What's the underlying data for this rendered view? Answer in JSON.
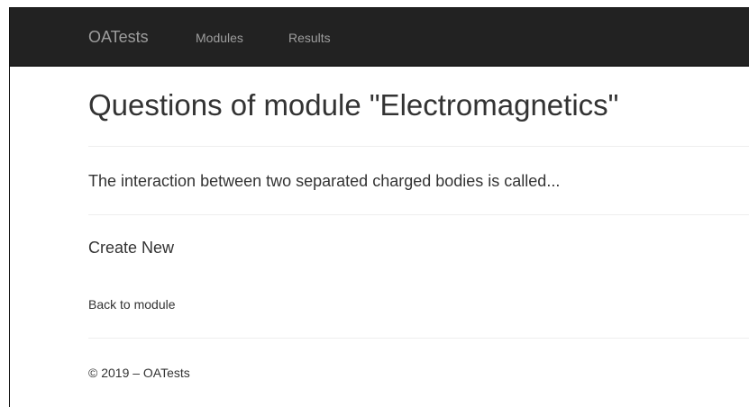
{
  "navbar": {
    "brand": "OATests",
    "links": [
      {
        "label": "Modules"
      },
      {
        "label": "Results"
      }
    ]
  },
  "main": {
    "title": "Questions of module \"Electromagnetics\"",
    "questions": [
      {
        "text": "The interaction between two separated charged bodies is called..."
      }
    ],
    "create_new_label": "Create New",
    "back_label": "Back to module"
  },
  "footer": {
    "text": "© 2019 – OATests"
  },
  "colors": {
    "navbar_bg": "#222222",
    "navbar_text": "#9d9d9d",
    "body_text": "#333333",
    "divider": "#eeeeee"
  }
}
